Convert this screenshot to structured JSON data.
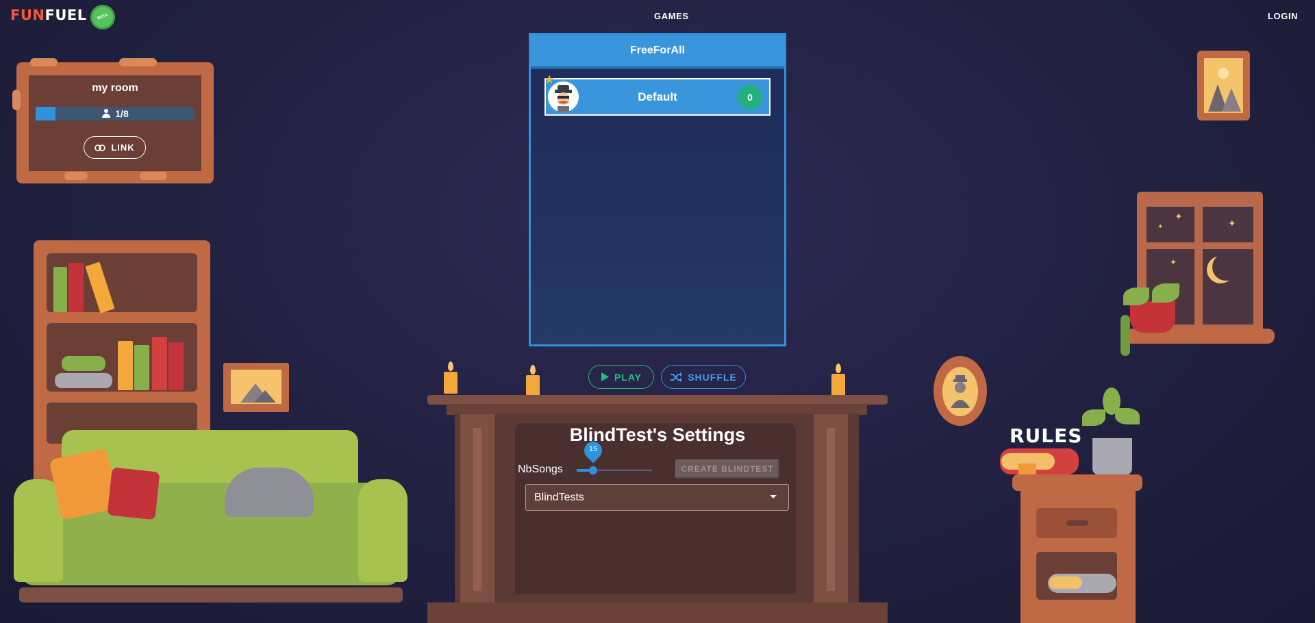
{
  "nav": {
    "logo_fun": "FUN",
    "logo_fuel": "FUEL",
    "badge_text": "BETA",
    "games": "GAMES",
    "login": "LOGIN"
  },
  "room": {
    "title": "my room",
    "players": "1/8",
    "player_fill_fraction": 0.125,
    "link_label": "LINK"
  },
  "team": {
    "mode": "FreeForAll",
    "rows": [
      {
        "name": "Default",
        "score": "0"
      }
    ]
  },
  "actions": {
    "play_label": "PLAY",
    "shuffle_label": "SHUFFLE"
  },
  "settings": {
    "title": "BlindTest's Settings",
    "nbsongs_label": "NbSongs",
    "nbsongs_value": "15",
    "create_label": "CREATE BLINDTEST",
    "select_value": "BlindTests"
  },
  "decor": {
    "rules_label": "RULES"
  },
  "colors": {
    "accent_blue": "#2f93db",
    "play_green": "#27c27a",
    "logo_orange": "#ef5b3a",
    "background": "#232244"
  }
}
